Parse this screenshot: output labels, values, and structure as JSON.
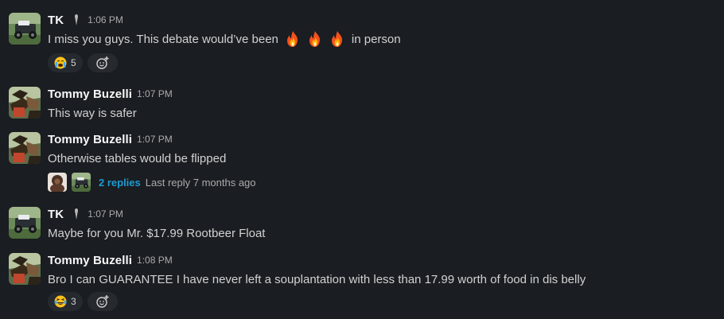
{
  "messages": [
    {
      "author": "TK",
      "time": "1:06 PM",
      "text_before": "I miss you guys. This debate would’ve been",
      "text_after": "in person",
      "emoji_inline": [
        "fire",
        "fire",
        "fire"
      ],
      "reactions": [
        {
          "emoji": "crying-face",
          "count": "5"
        }
      ]
    },
    {
      "author": "Tommy Buzelli",
      "time": "1:07 PM",
      "text": "This way is safer"
    },
    {
      "author": "Tommy Buzelli",
      "time": "1:07 PM",
      "text": "Otherwise tables would be flipped",
      "thread": {
        "replies": "2 replies",
        "last_reply": "Last reply 7 months ago"
      }
    },
    {
      "author": "TK",
      "time": "1:07 PM",
      "text": "Maybe for you Mr. $17.99 Rootbeer Float"
    },
    {
      "author": "Tommy Buzelli",
      "time": "1:08 PM",
      "text": "Bro I can GUARANTEE I have never left a souplantation with less than 17.99 worth of food in dis belly",
      "reactions": [
        {
          "emoji": "laughing-tears-face",
          "count": "3"
        }
      ]
    }
  ],
  "colors": {
    "background": "#1a1d21",
    "link": "#1d9bd1",
    "reaction_bg": "#26292e"
  }
}
